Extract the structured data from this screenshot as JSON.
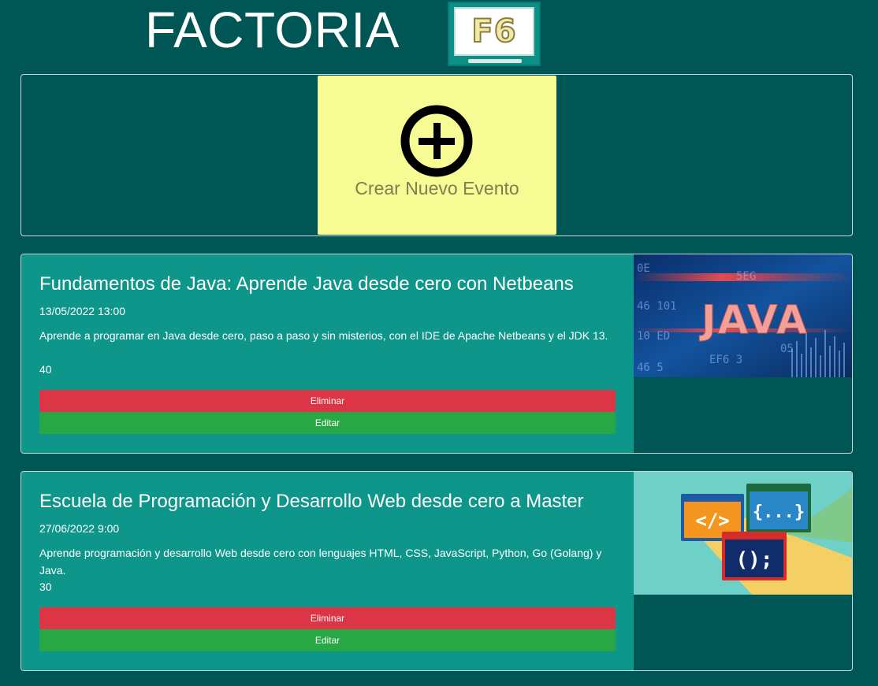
{
  "header": {
    "title": "FACTORIA",
    "logo_text": "F6"
  },
  "create": {
    "label": "Crear Nuevo Evento",
    "icon": "plus-circle-icon"
  },
  "events": [
    {
      "title": "Fundamentos de Java: Aprende Java desde cero con Netbeans",
      "date": "13/05/2022 13:00",
      "description": "Aprende a programar en Java desde cero, paso a paso y sin misterios, con el IDE de Apache Netbeans y el JDK 13.",
      "capacity": "40",
      "delete_label": "Eliminar",
      "edit_label": "Editar",
      "image_text": "JAVA"
    },
    {
      "title": "Escuela de Programación y Desarrollo Web desde cero a Master",
      "date": "27/06/2022 9:00",
      "description": "Aprende programación y desarrollo Web desde cero con lenguajes HTML, CSS, JavaScript, Python, Go (Golang) y Java.",
      "capacity": "30",
      "delete_label": "Eliminar",
      "edit_label": "Editar",
      "image_text": [
        "</>",
        "{...}",
        "();"
      ]
    }
  ],
  "colors": {
    "background": "#005555",
    "card": "#0e968a",
    "create_button": "#f7fb94",
    "delete": "#dc3545",
    "edit": "#28a745"
  }
}
